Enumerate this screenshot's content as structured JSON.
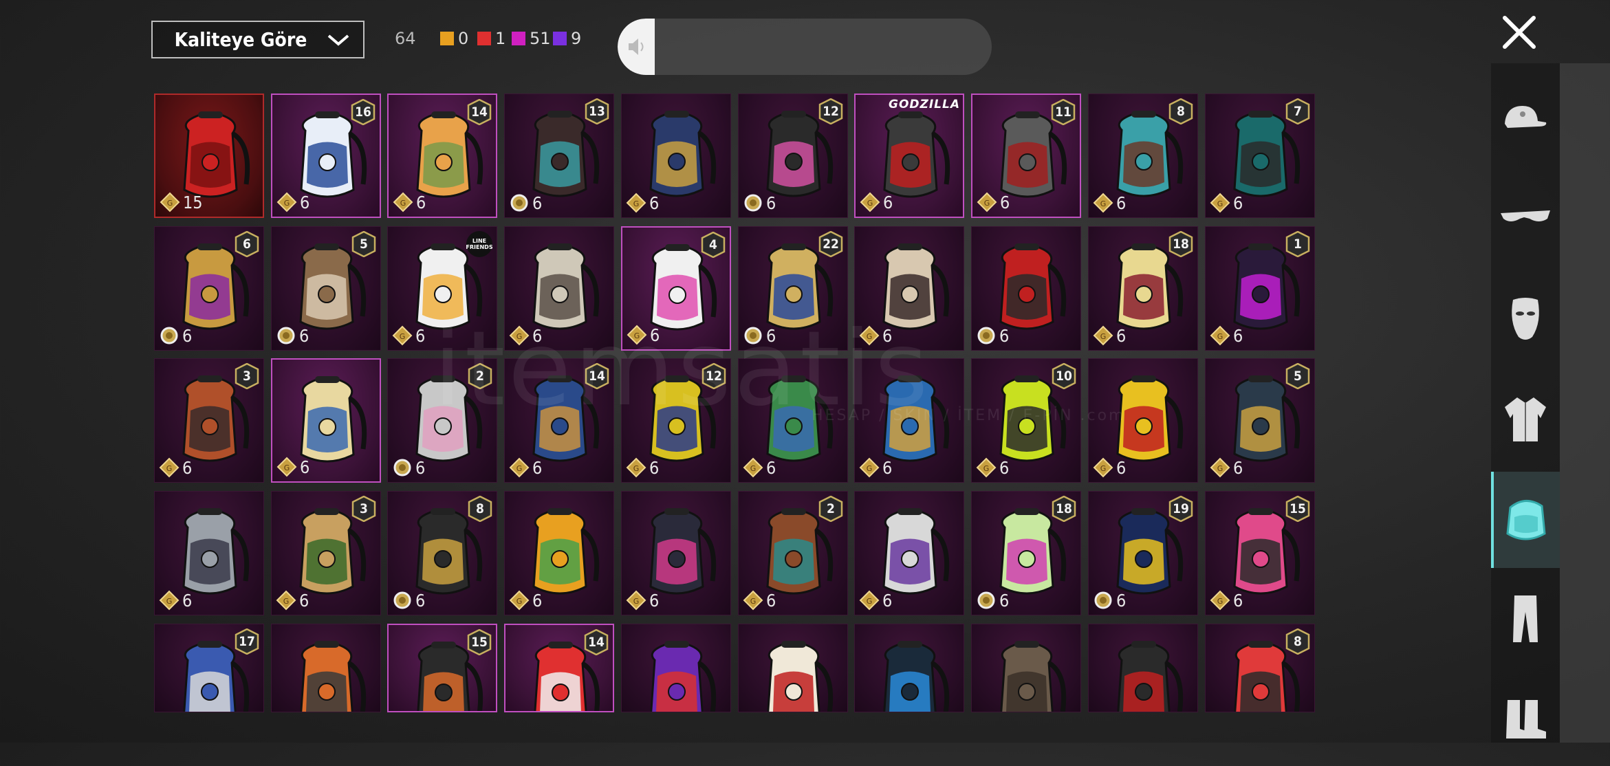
{
  "header": {
    "sort_label": "Kaliteye Göre",
    "total_count": "64",
    "quality_counts": [
      {
        "color": "#e8a020",
        "value": "0"
      },
      {
        "color": "#e03030",
        "value": "1"
      },
      {
        "color": "#d020c0",
        "value": "51"
      },
      {
        "color": "#7a30e0",
        "value": "9"
      }
    ],
    "search_placeholder": ""
  },
  "watermark": {
    "brand": "itemsatis",
    "tagline": "HESAP / SKIN / İTEM / E-PİN  .com"
  },
  "sidebar": {
    "categories": [
      {
        "name": "hat-icon",
        "active": false
      },
      {
        "name": "glasses-icon",
        "active": false
      },
      {
        "name": "mask-icon",
        "active": false
      },
      {
        "name": "jacket-icon",
        "active": false
      },
      {
        "name": "backpack-icon",
        "active": true
      },
      {
        "name": "pants-icon",
        "active": false
      },
      {
        "name": "boots-icon",
        "active": false
      }
    ]
  },
  "items": [
    {
      "count": "15",
      "level": "",
      "style": "red",
      "coin": "coin",
      "colors": [
        "#c22",
        "#7a1010"
      ]
    },
    {
      "count": "6",
      "level": "16",
      "style": "selected",
      "coin": "coin",
      "colors": [
        "#e8eef8",
        "#2b4f9a"
      ]
    },
    {
      "count": "6",
      "level": "14",
      "style": "selected",
      "coin": "coin",
      "colors": [
        "#e8a24a",
        "#7a9a4a"
      ]
    },
    {
      "count": "6",
      "level": "13",
      "style": "",
      "coin": "ring",
      "colors": [
        "#3a2a2a",
        "#3a9aa0"
      ]
    },
    {
      "count": "6",
      "level": "",
      "style": "",
      "coin": "coin",
      "colors": [
        "#2a3a6a",
        "#c8a040"
      ]
    },
    {
      "count": "6",
      "level": "12",
      "style": "",
      "coin": "ring",
      "colors": [
        "#2a2a2a",
        "#d050a0"
      ]
    },
    {
      "count": "6",
      "level": "",
      "brand": "GODZILLA",
      "style": "selected",
      "coin": "coin",
      "colors": [
        "#3a3a3a",
        "#c02020"
      ]
    },
    {
      "count": "6",
      "level": "11",
      "style": "selected",
      "coin": "coin",
      "colors": [
        "#5a5a5a",
        "#a02020"
      ]
    },
    {
      "count": "6",
      "level": "8",
      "style": "",
      "coin": "coin",
      "colors": [
        "#3aa0a8",
        "#6a3a2a"
      ]
    },
    {
      "count": "6",
      "level": "7",
      "style": "",
      "coin": "coin",
      "colors": [
        "#1a6a6a",
        "#2a2a2a"
      ]
    },
    {
      "count": "6",
      "level": "6",
      "style": "",
      "coin": "ring",
      "colors": [
        "#c89a40",
        "#8a2aa0"
      ]
    },
    {
      "count": "6",
      "level": "5",
      "style": "",
      "coin": "ring",
      "colors": [
        "#8a6a4a",
        "#d8c8b0"
      ]
    },
    {
      "count": "6",
      "level": "",
      "line": true,
      "style": "",
      "coin": "coin",
      "colors": [
        "#f0f0f0",
        "#f0b040"
      ]
    },
    {
      "count": "6",
      "level": "",
      "style": "",
      "coin": "coin",
      "colors": [
        "#cfc8b8",
        "#5a5048"
      ]
    },
    {
      "count": "6",
      "level": "4",
      "style": "selected",
      "coin": "coin",
      "colors": [
        "#f0f0f0",
        "#e050b0"
      ]
    },
    {
      "count": "6",
      "level": "22",
      "style": "",
      "coin": "ring",
      "colors": [
        "#d0b060",
        "#2a4a9a"
      ]
    },
    {
      "count": "6",
      "level": "",
      "style": "",
      "coin": "coin",
      "colors": [
        "#d8c8b0",
        "#3a2a2a"
      ]
    },
    {
      "count": "6",
      "level": "",
      "style": "",
      "coin": "ring",
      "colors": [
        "#c02020",
        "#2a2a2a"
      ]
    },
    {
      "count": "6",
      "level": "18",
      "style": "",
      "coin": "coin",
      "colors": [
        "#e8d890",
        "#8a2030"
      ]
    },
    {
      "count": "6",
      "level": "1",
      "style": "",
      "coin": "coin",
      "colors": [
        "#2a1a3a",
        "#c020d0"
      ]
    },
    {
      "count": "6",
      "level": "3",
      "style": "",
      "coin": "coin",
      "colors": [
        "#b0502a",
        "#3a2a2a"
      ]
    },
    {
      "count": "6",
      "level": "",
      "style": "selected",
      "coin": "coin",
      "colors": [
        "#e8d8a0",
        "#3a6ab0"
      ]
    },
    {
      "count": "6",
      "level": "2",
      "style": "",
      "coin": "ring",
      "colors": [
        "#c8c8c8",
        "#e0a0c0"
      ]
    },
    {
      "count": "6",
      "level": "14",
      "style": "",
      "coin": "coin",
      "colors": [
        "#2a4a8a",
        "#c89040"
      ]
    },
    {
      "count": "6",
      "level": "12",
      "style": "",
      "coin": "coin",
      "colors": [
        "#d8c020",
        "#2a3a8a"
      ]
    },
    {
      "count": "6",
      "level": "",
      "style": "",
      "coin": "coin",
      "colors": [
        "#3a8a4a",
        "#3a6ab0"
      ]
    },
    {
      "count": "6",
      "level": "",
      "style": "",
      "coin": "coin",
      "colors": [
        "#2a6ab0",
        "#d0a040"
      ]
    },
    {
      "count": "6",
      "level": "10",
      "style": "",
      "coin": "coin",
      "colors": [
        "#c8e020",
        "#2a2a2a"
      ]
    },
    {
      "count": "6",
      "level": "",
      "style": "",
      "coin": "coin",
      "colors": [
        "#e8c020",
        "#c02020"
      ]
    },
    {
      "count": "6",
      "level": "5",
      "style": "",
      "coin": "coin",
      "colors": [
        "#2a3a4a",
        "#c8a040"
      ]
    },
    {
      "count": "6",
      "level": "",
      "style": "",
      "coin": "coin",
      "colors": [
        "#9aa0a8",
        "#3a3a4a"
      ]
    },
    {
      "count": "6",
      "level": "3",
      "style": "",
      "coin": "coin",
      "colors": [
        "#c8a060",
        "#3a6a2a"
      ]
    },
    {
      "count": "6",
      "level": "8",
      "style": "",
      "coin": "ring",
      "colors": [
        "#2a2a2a",
        "#c8a040"
      ]
    },
    {
      "count": "6",
      "level": "",
      "style": "",
      "coin": "coin",
      "colors": [
        "#e8a020",
        "#4aa04a"
      ]
    },
    {
      "count": "6",
      "level": "",
      "style": "",
      "coin": "coin",
      "colors": [
        "#2a2a3a",
        "#d03a8a"
      ]
    },
    {
      "count": "6",
      "level": "2",
      "style": "",
      "coin": "coin",
      "colors": [
        "#8a4a2a",
        "#2a8a8a"
      ]
    },
    {
      "count": "6",
      "level": "",
      "style": "",
      "coin": "coin",
      "colors": [
        "#d8d8d8",
        "#6a3aa0"
      ]
    },
    {
      "count": "6",
      "level": "18",
      "style": "",
      "coin": "ring",
      "colors": [
        "#c8e8a0",
        "#d040b0"
      ]
    },
    {
      "count": "6",
      "level": "19",
      "style": "",
      "coin": "ring",
      "colors": [
        "#1a2a5a",
        "#e8c020"
      ]
    },
    {
      "count": "6",
      "level": "15",
      "style": "",
      "coin": "coin",
      "colors": [
        "#e04a8a",
        "#2a2a2a"
      ]
    },
    {
      "count": "",
      "level": "17",
      "style": "",
      "coin": "",
      "colors": [
        "#3a5ab0",
        "#d8d8d8"
      ]
    },
    {
      "count": "",
      "level": "",
      "style": "",
      "coin": "",
      "colors": [
        "#d86a2a",
        "#3a3a3a"
      ]
    },
    {
      "count": "",
      "level": "15",
      "style": "selected",
      "coin": "",
      "colors": [
        "#2a2a2a",
        "#d86a2a"
      ]
    },
    {
      "count": "",
      "level": "14",
      "style": "selected",
      "coin": "",
      "colors": [
        "#e03030",
        "#f0f0f0"
      ]
    },
    {
      "count": "",
      "level": "",
      "style": "",
      "coin": "",
      "colors": [
        "#6a2ab0",
        "#d83030"
      ]
    },
    {
      "count": "",
      "level": "",
      "style": "",
      "coin": "",
      "colors": [
        "#f0e8d8",
        "#c02020"
      ]
    },
    {
      "count": "",
      "level": "",
      "style": "",
      "coin": "",
      "colors": [
        "#1a2a3a",
        "#2a8ad8"
      ]
    },
    {
      "count": "",
      "level": "",
      "style": "",
      "coin": "",
      "colors": [
        "#6a5a4a",
        "#3a3028"
      ]
    },
    {
      "count": "",
      "level": "",
      "style": "",
      "coin": "",
      "colors": [
        "#2a2a2a",
        "#c02020"
      ]
    },
    {
      "count": "",
      "level": "8",
      "style": "",
      "coin": "",
      "colors": [
        "#e03a3a",
        "#2a2a2a"
      ]
    }
  ]
}
